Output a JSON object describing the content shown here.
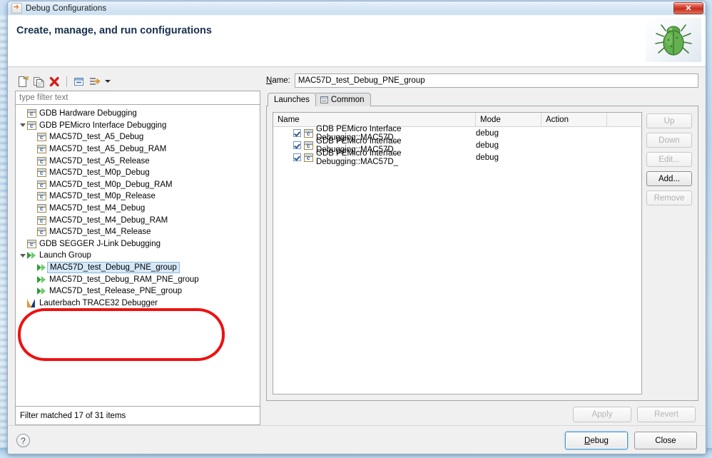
{
  "window": {
    "title": "Debug Configurations",
    "title_icon": "eclipse-debug-icon",
    "close_label": "✕"
  },
  "header": {
    "title": "Create, manage, and run configurations",
    "decoration_icon": "green-bug-icon"
  },
  "left_panel": {
    "toolbar": {
      "new_icon": "new-launch-configuration-icon",
      "duplicate_icon": "duplicate-icon",
      "delete_icon": "delete-red-x-icon",
      "collapse_icon": "collapse-all-icon",
      "filter_icon": "filter-launch-configurations-icon",
      "menu_caret_icon": "chevron-down-icon"
    },
    "filter": {
      "placeholder": "type filter text",
      "value": ""
    },
    "status": "Filter matched 17 of 31 items",
    "tree": [
      {
        "label": "GDB Hardware Debugging",
        "indent": 0,
        "icon": "c-config-icon",
        "twisty": "none",
        "selected": false
      },
      {
        "label": "GDB PEMicro Interface Debugging",
        "indent": 0,
        "icon": "c-config-icon",
        "twisty": "open",
        "selected": false
      },
      {
        "label": "MAC57D_test_A5_Debug",
        "indent": 1,
        "icon": "c-config-icon",
        "twisty": "none",
        "selected": false
      },
      {
        "label": "MAC57D_test_A5_Debug_RAM",
        "indent": 1,
        "icon": "c-config-icon",
        "twisty": "none",
        "selected": false
      },
      {
        "label": "MAC57D_test_A5_Release",
        "indent": 1,
        "icon": "c-config-icon",
        "twisty": "none",
        "selected": false
      },
      {
        "label": "MAC57D_test_M0p_Debug",
        "indent": 1,
        "icon": "c-config-icon",
        "twisty": "none",
        "selected": false
      },
      {
        "label": "MAC57D_test_M0p_Debug_RAM",
        "indent": 1,
        "icon": "c-config-icon",
        "twisty": "none",
        "selected": false
      },
      {
        "label": "MAC57D_test_M0p_Release",
        "indent": 1,
        "icon": "c-config-icon",
        "twisty": "none",
        "selected": false
      },
      {
        "label": "MAC57D_test_M4_Debug",
        "indent": 1,
        "icon": "c-config-icon",
        "twisty": "none",
        "selected": false
      },
      {
        "label": "MAC57D_test_M4_Debug_RAM",
        "indent": 1,
        "icon": "c-config-icon",
        "twisty": "none",
        "selected": false
      },
      {
        "label": "MAC57D_test_M4_Release",
        "indent": 1,
        "icon": "c-config-icon",
        "twisty": "none",
        "selected": false
      },
      {
        "label": "GDB SEGGER J-Link Debugging",
        "indent": 0,
        "icon": "c-config-icon",
        "twisty": "none",
        "selected": false
      },
      {
        "label": "Launch Group",
        "indent": 0,
        "icon": "green-play-icon",
        "twisty": "open",
        "selected": false
      },
      {
        "label": "MAC57D_test_Debug_PNE_group",
        "indent": 1,
        "icon": "green-play-icon",
        "twisty": "none",
        "selected": true
      },
      {
        "label": "MAC57D_test_Debug_RAM_PNE_group",
        "indent": 1,
        "icon": "green-play-icon",
        "twisty": "none",
        "selected": false
      },
      {
        "label": "MAC57D_test_Release_PNE_group",
        "indent": 1,
        "icon": "green-play-icon",
        "twisty": "none",
        "selected": false
      },
      {
        "label": "Lauterbach TRACE32 Debugger",
        "indent": 0,
        "icon": "lauterbach-icon",
        "twisty": "none",
        "selected": false
      }
    ]
  },
  "right_panel": {
    "name_label": "Name:",
    "name_value": "MAC57D_test_Debug_PNE_group",
    "tabs": [
      {
        "label": "Launches",
        "active": true,
        "icon": ""
      },
      {
        "label": "Common",
        "active": false,
        "icon": "common-tab-icon"
      }
    ],
    "table": {
      "columns": [
        "Name",
        "Mode",
        "Action",
        ""
      ],
      "rows": [
        {
          "checked": true,
          "icon": "c-config-icon",
          "name": "GDB PEMicro Interface Debugging::MAC57D_",
          "mode": "debug",
          "action": ""
        },
        {
          "checked": true,
          "icon": "c-config-icon",
          "name": "GDB PEMicro Interface Debugging::MAC57D_",
          "mode": "debug",
          "action": ""
        },
        {
          "checked": true,
          "icon": "c-config-icon",
          "name": "GDB PEMicro Interface Debugging::MAC57D_",
          "mode": "debug",
          "action": ""
        }
      ]
    },
    "side_buttons": [
      {
        "label": "Up",
        "enabled": false
      },
      {
        "label": "Down",
        "enabled": false
      },
      {
        "label": "Edit...",
        "enabled": false
      },
      {
        "label": "Add...",
        "enabled": true
      },
      {
        "label": "Remove",
        "enabled": false
      }
    ],
    "apply_label": "Apply",
    "revert_label": "Revert"
  },
  "footer": {
    "help_icon": "help-question-icon",
    "debug_label": "Debug",
    "close_label": "Close"
  },
  "annotation": {
    "shape": "red-oval-highlight",
    "color": "#ee1111"
  }
}
